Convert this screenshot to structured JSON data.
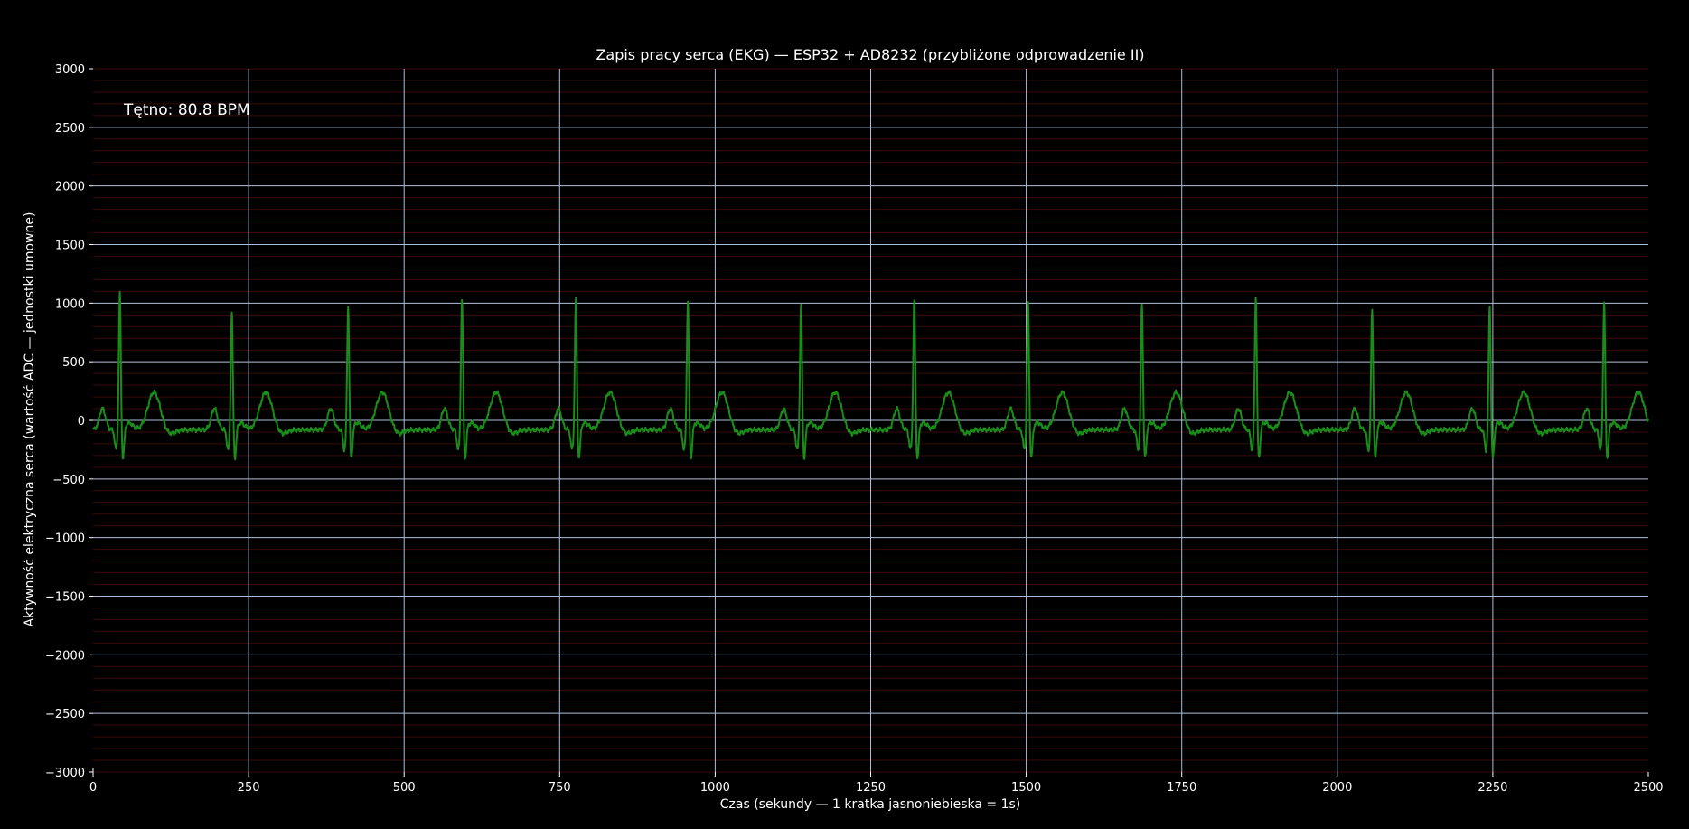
{
  "chart_data": {
    "type": "line",
    "title": "Zapis pracy serca (EKG) — ESP32 + AD8232 (przybliżone odprowadzenie II)",
    "xlabel": "Czas (sekundy — 1 kratka jasnoniebieska = 1s)",
    "ylabel": "Aktywność elektryczna serca (wartość ADC — jednostki umowne)",
    "annotation": "Tętno: 80.8 BPM",
    "xlim": [
      0,
      2500
    ],
    "ylim": [
      -3000,
      3000
    ],
    "x_ticks": [
      0,
      250,
      500,
      750,
      1000,
      1250,
      1500,
      1750,
      2000,
      2250,
      2500
    ],
    "x_tick_labels": [
      "0",
      "250",
      "500",
      "750",
      "1000",
      "1250",
      "1500",
      "1750",
      "2000",
      "2250",
      "2500"
    ],
    "y_ticks": [
      -3000,
      -2500,
      -2000,
      -1500,
      -1000,
      -500,
      0,
      500,
      1000,
      1500,
      2000,
      2500,
      3000
    ],
    "y_tick_labels": [
      "−3000",
      "−2500",
      "−2000",
      "−1500",
      "−1000",
      "−500",
      "0",
      "500",
      "1000",
      "1500",
      "2000",
      "2500",
      "3000"
    ],
    "grid": true,
    "legend": "none",
    "colors": {
      "background": "#000000",
      "line": "#1a8c1a",
      "major_grid": "#aabfd9",
      "minor_grid": "#3a0a0a",
      "text": "#ffffff"
    },
    "series": [
      {
        "beats": [
          {
            "r": 43,
            "peak": 1100
          },
          {
            "r": 223,
            "peak": 940
          },
          {
            "r": 410,
            "peak": 980
          },
          {
            "r": 593,
            "peak": 1040
          },
          {
            "r": 776,
            "peak": 1040
          },
          {
            "r": 956,
            "peak": 1020
          },
          {
            "r": 1138,
            "peak": 1010
          },
          {
            "r": 1320,
            "peak": 1030
          },
          {
            "r": 1503,
            "peak": 1000
          },
          {
            "r": 1686,
            "peak": 1000
          },
          {
            "r": 1869,
            "peak": 1060
          },
          {
            "r": 2056,
            "peak": 960
          },
          {
            "r": 2245,
            "peak": 990
          },
          {
            "r": 2429,
            "peak": 1020
          }
        ],
        "baseline": -80,
        "t_wave_amplitude": 320,
        "p_wave_amplitude": 180
      }
    ]
  }
}
